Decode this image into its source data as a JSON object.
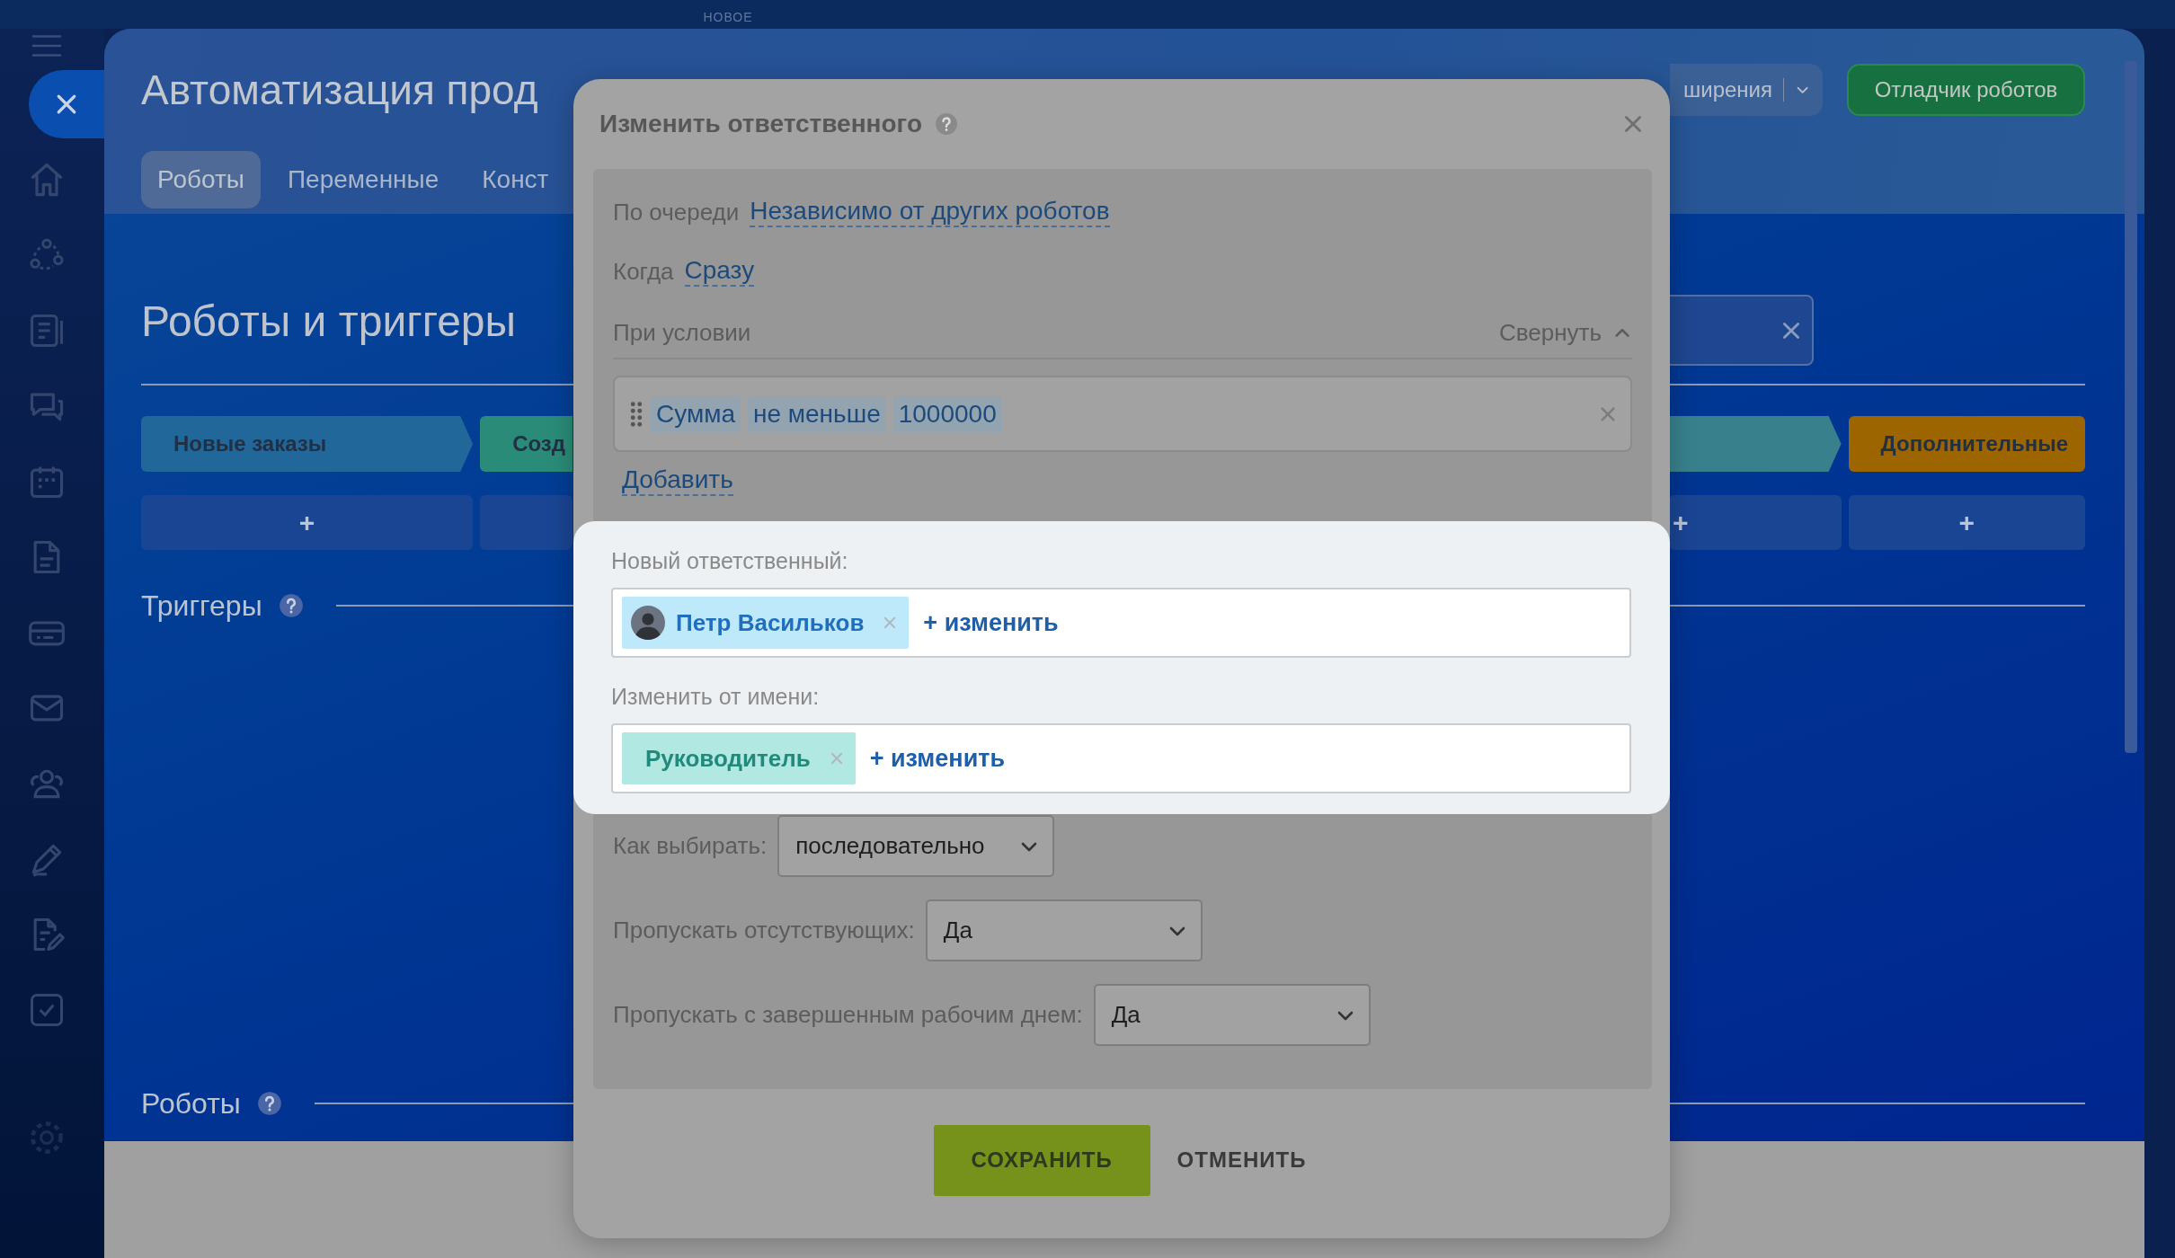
{
  "top_bar": {
    "label": "НОВОЕ"
  },
  "header": {
    "title": "Автоматизация прод",
    "tabs": [
      {
        "label": "Роботы",
        "selected": true
      },
      {
        "label": "Переменные",
        "selected": false
      },
      {
        "label": "Конст",
        "selected": false
      }
    ],
    "extensions_button": "ширения",
    "debugger_button": "Отладчик роботов"
  },
  "content": {
    "heading": "Роботы и триггеры",
    "stages": [
      {
        "name": "Новые заказы",
        "color": "#22679a",
        "add": "+"
      },
      {
        "name": "Созд",
        "color": "#2a8c78"
      },
      {
        "color": "#38818c",
        "add": "+"
      },
      {
        "name": "Дополнительные",
        "color": "#9c6500",
        "add": "+"
      }
    ],
    "sections": [
      {
        "title": "Триггеры"
      },
      {
        "title": "Роботы"
      }
    ]
  },
  "modal": {
    "title": "Изменить ответственного",
    "order": {
      "label": "По очереди",
      "value": "Независимо от других роботов"
    },
    "when": {
      "label": "Когда",
      "value": "Сразу"
    },
    "condition": {
      "label": "При условии",
      "toggle": "Свернуть",
      "chips": [
        "Сумма",
        "не меньше",
        "1000000"
      ],
      "add": "Добавить"
    },
    "responsible": {
      "label": "Новый ответственный:",
      "tags": [
        {
          "text": "Петр Васильков",
          "kind": "user"
        }
      ],
      "change": "+ изменить"
    },
    "on_behalf": {
      "label": "Изменить от имени:",
      "tags": [
        {
          "text": "Руководитель",
          "kind": "role"
        }
      ],
      "change": "+ изменить"
    },
    "selects": [
      {
        "label": "Как выбирать:",
        "value": "последовательно"
      },
      {
        "label": "Пропускать отсутствующих:",
        "value": "Да"
      },
      {
        "label": "Пропускать с завершенным рабочим днем:",
        "value": "Да"
      }
    ],
    "buttons": [
      {
        "label": "СОХРАНИТЬ",
        "kind": "primary"
      },
      {
        "label": "ОТМЕНИТЬ",
        "kind": "link"
      }
    ]
  }
}
